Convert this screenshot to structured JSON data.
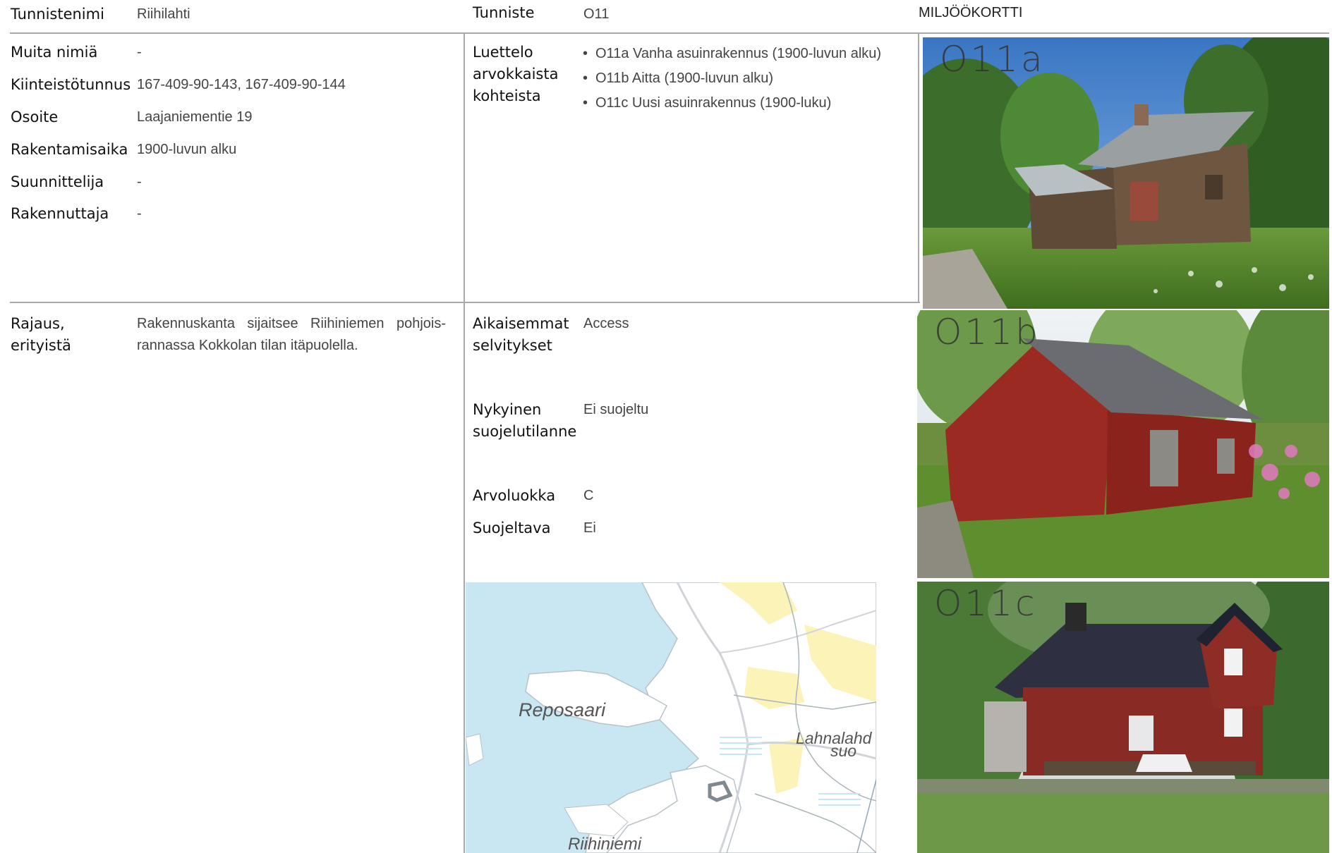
{
  "header": {
    "name_label": "Tunnistenimi",
    "name_value": "Riihilahti",
    "id_label": "Tunniste",
    "id_value": "O11",
    "card_title": "MILJÖÖKORTTI"
  },
  "info": {
    "muita_label": "Muita nimiä",
    "muita_value": "-",
    "kiinteisto_label": "Kiinteistötunnus",
    "kiinteisto_value": "167-409-90-143, 167-409-90-144",
    "osoite_label": "Osoite",
    "osoite_value": "Laajaniementie 19",
    "rakentamisaika_label": "Rakentamisaika",
    "rakentamisaika_value": "1900-luvun alku",
    "suunnittelija_label": "Suunnittelija",
    "suunnittelija_value": "-",
    "rakennuttaja_label": "Rakennuttaja",
    "rakennuttaja_value": "-"
  },
  "objects": {
    "label_line1": "Luettelo",
    "label_line2": "arvokkaista",
    "label_line3": "kohteista",
    "items": [
      "O11a Vanha asuinrakennus (1900-luvun alku)",
      "O11b Aitta (1900-luvun alku)",
      "O11c Uusi asuinrakennus (1900-luku)"
    ]
  },
  "rajaus": {
    "label_line1": "Rajaus,",
    "label_line2": "erityistä",
    "text": "Rakennuskanta sijaitsee Riihiniemen pohjoisrannassa Kokkolan tilan itäpuolella.",
    "text_line1": "Rakennuskanta sijaitsee Riihiniemen pohjois-",
    "text_line2": "rannassa Kokkolan tilan itäpuolella."
  },
  "status": {
    "aikaisemmat_label_line1": "Aikaisemmat",
    "aikaisemmat_label_line2": "selvitykset",
    "aikaisemmat_value": "Access",
    "nykyinen_label_line1": "Nykyinen",
    "nykyinen_label_line2": "suojelutilanne",
    "nykyinen_value": "Ei suojeltu",
    "arvoluokka_label": "Arvoluokka",
    "arvoluokka_value": "C",
    "suojeltava_label": "Suojeltava",
    "suojeltava_value": "Ei"
  },
  "map": {
    "label_reposaari": "Reposaari",
    "label_lahnalahti_1": "Lahnalahd",
    "label_lahnalahti_2": "suo",
    "label_riihiniemi": "Riihiniemi",
    "water_color": "#c9e6f3",
    "land_color": "#ffffff",
    "field_color": "#fbf3b8"
  },
  "photos": {
    "a_tag": "O11a",
    "b_tag": "O11b",
    "c_tag": "O11c"
  }
}
